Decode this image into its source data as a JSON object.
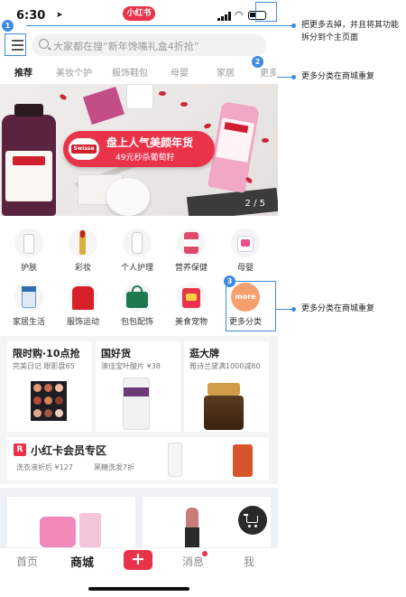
{
  "status_bar": {
    "time": "6:30",
    "app_name": "小红书"
  },
  "search": {
    "placeholder": "大家都在搜“新年馋嘴礼盒4折抢”"
  },
  "tabs": [
    {
      "label": "推荐",
      "active": true
    },
    {
      "label": "美妆个护",
      "active": false
    },
    {
      "label": "服饰鞋包",
      "active": false
    },
    {
      "label": "母婴",
      "active": false
    },
    {
      "label": "家居",
      "active": false
    },
    {
      "label": "更多",
      "active": false
    }
  ],
  "banner": {
    "brand": "Swisse",
    "headline": "盘上人气美颜年货",
    "subline": "49元秒杀葡萄籽",
    "page_indicator": "2 / 5"
  },
  "categories": [
    {
      "label": "护肤",
      "icon": "skincare-icon"
    },
    {
      "label": "彩妆",
      "icon": "makeup-icon"
    },
    {
      "label": "个人护理",
      "icon": "personal-care-icon"
    },
    {
      "label": "营养保健",
      "icon": "nutrition-icon"
    },
    {
      "label": "母婴",
      "icon": "baby-icon"
    },
    {
      "label": "家居生活",
      "icon": "home-living-icon"
    },
    {
      "label": "服饰运动",
      "icon": "apparel-icon"
    },
    {
      "label": "包包配饰",
      "icon": "bag-icon"
    },
    {
      "label": "美食宠物",
      "icon": "food-pet-icon"
    },
    {
      "label": "更多分类",
      "icon": "more-icon",
      "icon_text": "more"
    }
  ],
  "promos": [
    {
      "title": "限时购·10点抢",
      "subtitle": "完美日记 眼影盘65"
    },
    {
      "title": "国好货",
      "subtitle": "澳佳宝叶酸片 ¥38"
    },
    {
      "title": "逛大牌",
      "subtitle": "雅诗兰黛满1000减80"
    }
  ],
  "member": {
    "badge": "R",
    "title": "小红卡会员专区",
    "item1": "洗衣液折后 ¥127",
    "item2": "黑糖洗发7折"
  },
  "bottom_nav": [
    {
      "label": "首页",
      "active": false
    },
    {
      "label": "商城",
      "active": true
    },
    {
      "label": "+",
      "active": false
    },
    {
      "label": "消息",
      "active": false
    },
    {
      "label": "我",
      "active": false
    }
  ],
  "annotations": [
    {
      "num": "1",
      "text": "把更多去掉，并且将其功能拆分到个主页面"
    },
    {
      "num": "2",
      "text": "更多分类在商城重复"
    },
    {
      "num": "3",
      "text": "更多分类在商城重复"
    }
  ],
  "colors": {
    "brand_red": "#e8334a",
    "annotation_blue": "#3f8ae0"
  }
}
